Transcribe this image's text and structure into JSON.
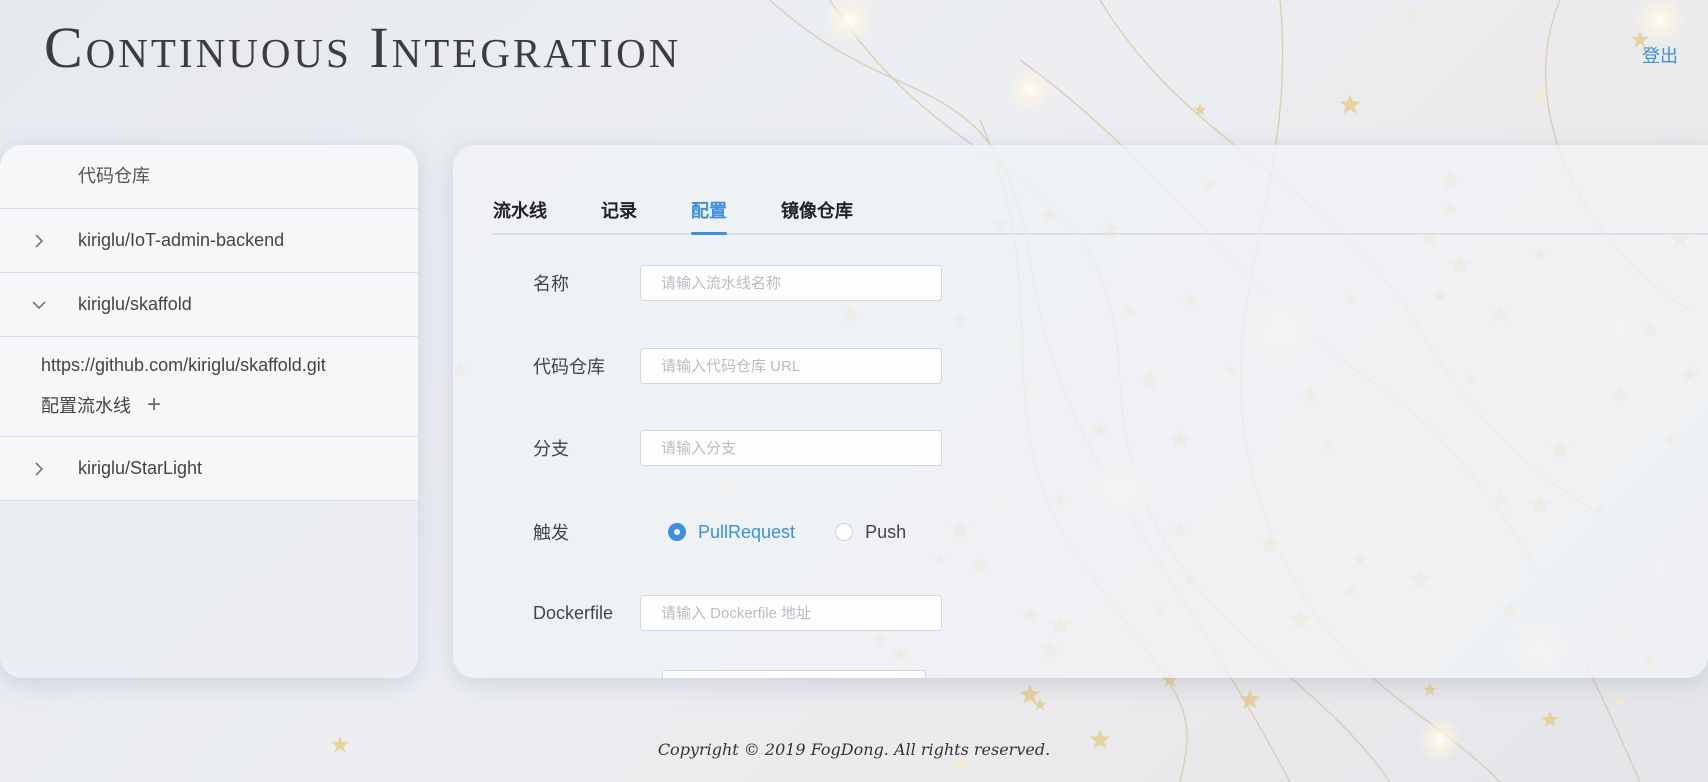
{
  "header": {
    "title": "Continuous Integration",
    "logout_label": "登出"
  },
  "sidebar": {
    "header_label": "代码仓库",
    "repos": [
      {
        "label": "kiriglu/IoT-admin-backend",
        "expanded": false
      },
      {
        "label": "kiriglu/skaffold",
        "expanded": true,
        "url": "https://github.com/kiriglu/skaffold.git",
        "action_label": "配置流水线",
        "action_icon": "plus-icon"
      },
      {
        "label": "kiriglu/StarLight",
        "expanded": false
      }
    ]
  },
  "main": {
    "tabs": [
      {
        "label": "流水线",
        "active": false
      },
      {
        "label": "记录",
        "active": false
      },
      {
        "label": "配置",
        "active": true
      },
      {
        "label": "镜像仓库",
        "active": false
      }
    ],
    "form": {
      "name": {
        "label": "名称",
        "placeholder": "请输入流水线名称",
        "value": ""
      },
      "repo": {
        "label": "代码仓库",
        "placeholder": "请输入代码仓库 URL",
        "value": ""
      },
      "branch": {
        "label": "分支",
        "placeholder": "请输入分支",
        "value": ""
      },
      "trigger": {
        "label": "触发",
        "options": [
          {
            "label": "PullRequest",
            "checked": true
          },
          {
            "label": "Push",
            "checked": false
          }
        ]
      },
      "dockerfile": {
        "label": "Dockerfile",
        "placeholder": "请输入 Dockerfile 地址",
        "value": ""
      }
    }
  },
  "footer": {
    "copyright": "Copyright © 2019 FogDong. All rights reserved."
  },
  "colors": {
    "accent": "#3d8fe0",
    "title": "#3b3d42"
  }
}
